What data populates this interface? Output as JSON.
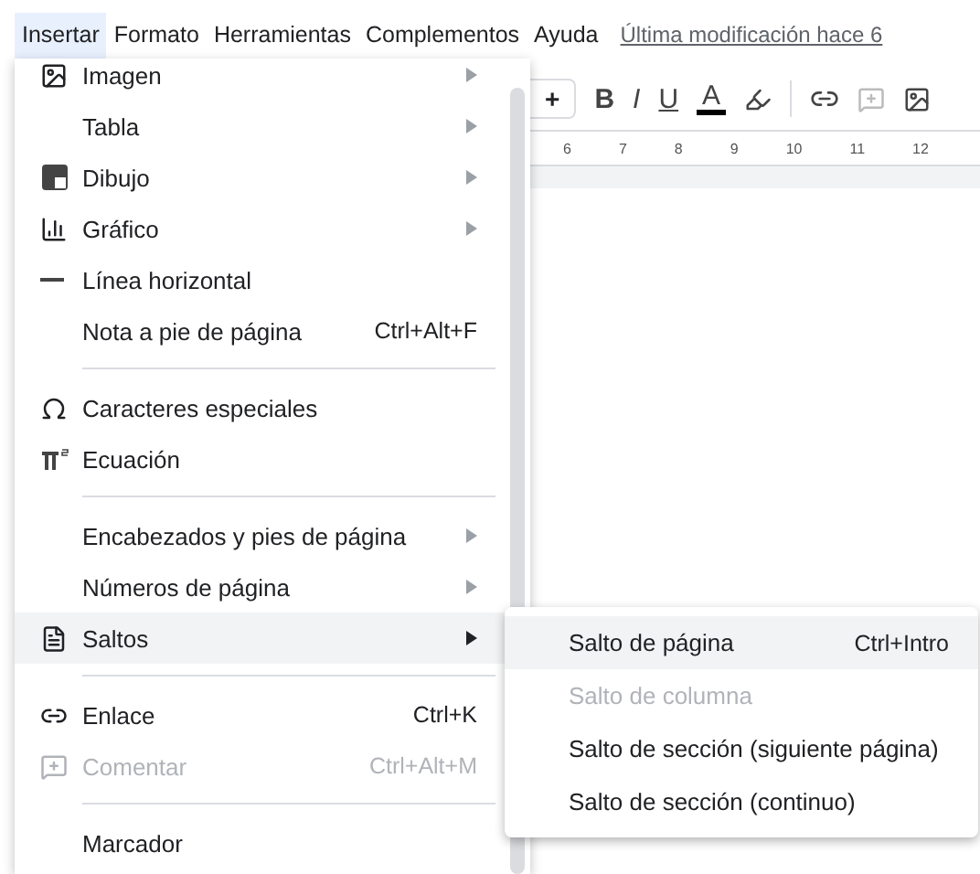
{
  "menubar": [
    {
      "label": "Insertar",
      "selected": true
    },
    {
      "label": "Formato",
      "selected": false
    },
    {
      "label": "Herramientas",
      "selected": false
    },
    {
      "label": "Complementos",
      "selected": false
    },
    {
      "label": "Ayuda",
      "selected": false
    }
  ],
  "last_edit": "Última modificación hace 6",
  "toolbar": {
    "plus": "+",
    "bold": "B",
    "italic": "I",
    "underline": "U",
    "text_color": "A"
  },
  "ruler": [
    "6",
    "7",
    "8",
    "9",
    "10",
    "11",
    "12"
  ],
  "menu": [
    {
      "kind": "item",
      "label": "Imagen",
      "submenu": true
    },
    {
      "kind": "item",
      "label": "Tabla",
      "submenu": true
    },
    {
      "kind": "item",
      "label": "Dibujo",
      "submenu": true
    },
    {
      "kind": "item",
      "label": "Gráfico",
      "submenu": true
    },
    {
      "kind": "item",
      "label": "Línea horizontal"
    },
    {
      "kind": "item",
      "label": "Nota a pie de página",
      "shortcut": "Ctrl+Alt+F"
    },
    {
      "kind": "separator"
    },
    {
      "kind": "item",
      "label": "Caracteres especiales"
    },
    {
      "kind": "item",
      "label": "Ecuación"
    },
    {
      "kind": "separator"
    },
    {
      "kind": "item",
      "label": "Encabezados y pies de página",
      "submenu": true
    },
    {
      "kind": "item",
      "label": "Números de página",
      "submenu": true
    },
    {
      "kind": "item",
      "label": "Saltos",
      "submenu": true,
      "selected": true
    },
    {
      "kind": "separator"
    },
    {
      "kind": "item",
      "label": "Enlace",
      "shortcut": "Ctrl+K"
    },
    {
      "kind": "item",
      "label": "Comentar",
      "shortcut": "Ctrl+Alt+M",
      "disabled": true
    },
    {
      "kind": "separator"
    },
    {
      "kind": "item",
      "label": "Marcador"
    }
  ],
  "submenu": [
    {
      "label": "Salto de página",
      "shortcut": "Ctrl+Intro",
      "selected": true,
      "disabled": false
    },
    {
      "label": "Salto de columna",
      "selected": false,
      "disabled": true
    },
    {
      "label": "Salto de sección (siguiente página)",
      "selected": false,
      "disabled": false
    },
    {
      "label": "Salto de sección (continuo)",
      "selected": false,
      "disabled": false
    }
  ]
}
